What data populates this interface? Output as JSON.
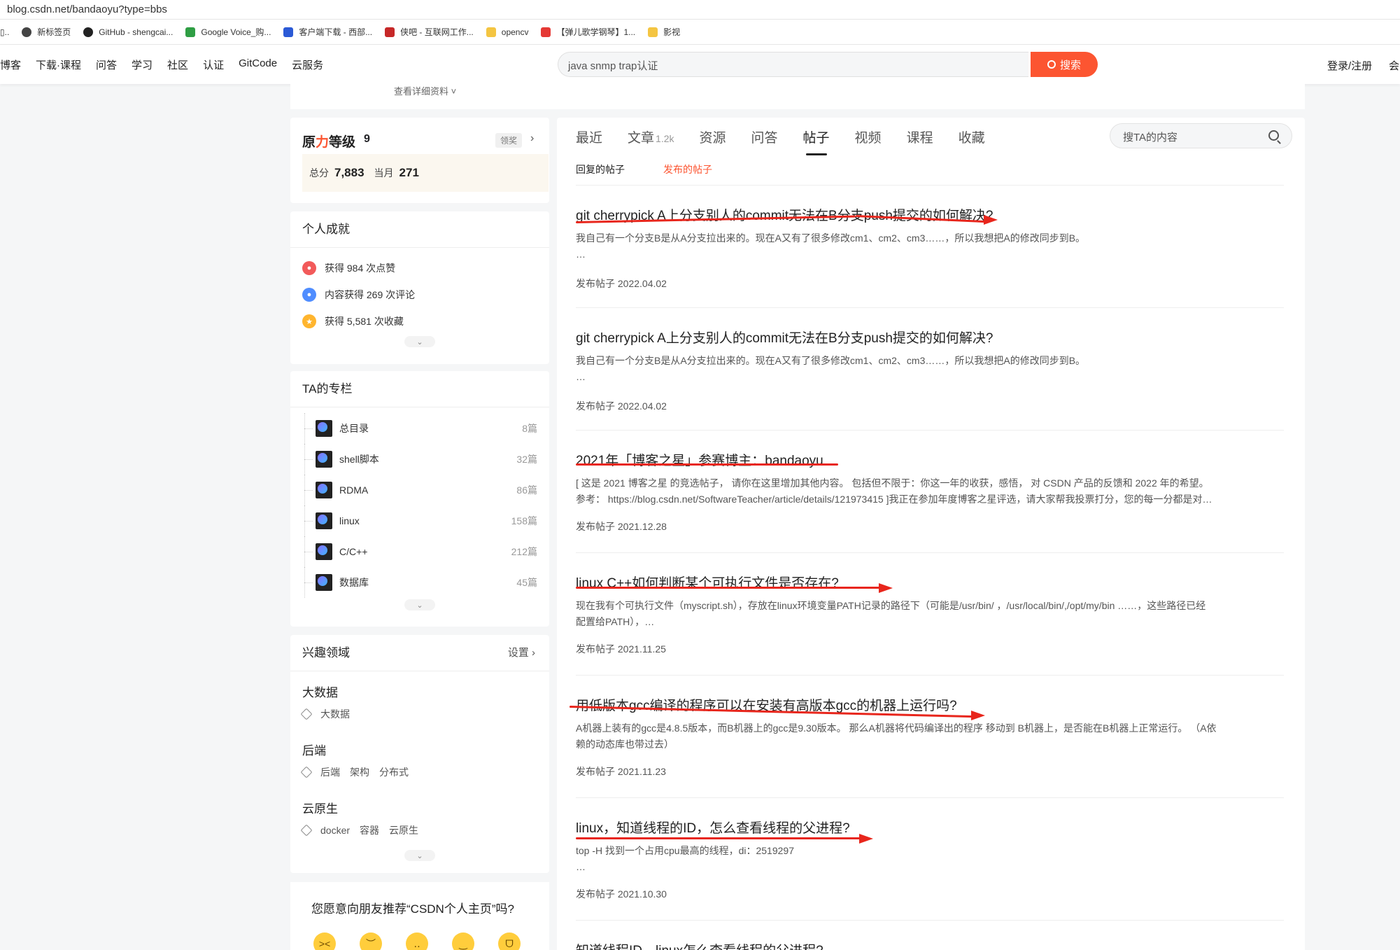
{
  "browser": {
    "url": "blog.csdn.net/bandaoyu?type=bbs",
    "bookmarks": [
      "新标签页",
      "GitHub - shengcai...",
      "Google Voice_购...",
      "客户端下载 - 西部...",
      "侠吧 - 互联网工作...",
      "opencv",
      "【弹儿歌学钢琴】1...",
      "影视"
    ],
    "bookmark_colors": [
      "#444444",
      "#222222",
      "#2f9e44",
      "#2b5ad6",
      "#c62828",
      "#f4c542",
      "#e53935",
      "#f4c542"
    ]
  },
  "topnav": {
    "links": [
      "博客",
      "下载·课程",
      "问答",
      "学习",
      "社区",
      "认证",
      "GitCode",
      "云服务"
    ],
    "search_value": "java snmp trap认证",
    "search_button": "搜索",
    "login": "登录/注册",
    "extra": "会"
  },
  "profile_strip": {
    "text": "查看详细资料 ˅"
  },
  "level": {
    "title_prefix": "原",
    "title_red": "力",
    "title_suffix": "等级",
    "value": "9",
    "award": "领奖",
    "total_label": "总分",
    "total": "7,883",
    "month_label": "当月",
    "month": "271"
  },
  "achievements": {
    "title": "个人成就",
    "items": [
      {
        "text": "获得 984 次点赞",
        "color": "#f25a5a"
      },
      {
        "text": "内容获得 269 次评论",
        "color": "#4f8dff"
      },
      {
        "text": "获得 5,581 次收藏",
        "color": "#ffb52e"
      }
    ]
  },
  "columns": {
    "title": "TA的专栏",
    "items": [
      {
        "name": "总目录",
        "count": "8篇"
      },
      {
        "name": "shell脚本",
        "count": "32篇"
      },
      {
        "name": "RDMA",
        "count": "86篇"
      },
      {
        "name": "linux",
        "count": "158篇"
      },
      {
        "name": "C/C++",
        "count": "212篇"
      },
      {
        "name": "数据库",
        "count": "45篇"
      }
    ]
  },
  "interests": {
    "title": "兴趣领域",
    "settings": "设置",
    "groups": [
      {
        "head": "大数据",
        "tags": [
          "大数据"
        ]
      },
      {
        "head": "后端",
        "tags": [
          "后端",
          "架构",
          "分布式"
        ]
      },
      {
        "head": "云原生",
        "tags": [
          "docker",
          "容器",
          "云原生"
        ]
      }
    ]
  },
  "recommend": {
    "text": "您愿意向朋友推荐“CSDN个人主页”吗?"
  },
  "tabs": {
    "items": [
      "最近",
      "文章",
      "资源",
      "问答",
      "帖子",
      "视频",
      "课程",
      "收藏"
    ],
    "article_count": "1.2k",
    "active": "帖子",
    "search_placeholder": "搜TA的内容",
    "sub": [
      "回复的帖子",
      "发布的帖子"
    ]
  },
  "posts": [
    {
      "title": "git cherrypick A上分支别人的commit无法在B分支push提交的如何解决?",
      "desc": "我自己有一个分支B是从A分支拉出来的。现在A又有了很多修改cm1、cm2、cm3……，所以我想把A的修改同步到B。",
      "desc2": "…",
      "date": "发布帖子 2022.04.02"
    },
    {
      "title": "git cherrypick A上分支别人的commit无法在B分支push提交的如何解决?",
      "desc": "我自己有一个分支B是从A分支拉出来的。现在A又有了很多修改cm1、cm2、cm3……，所以我想把A的修改同步到B。",
      "desc2": "…",
      "date": "发布帖子 2022.04.02"
    },
    {
      "title": "2021年「博客之星」参赛博主：bandaoyu",
      "desc": "[ 这是 2021 博客之星 的竞选帖子， 请你在这里增加其他内容。 包括但不限于：你这一年的收获，感悟， 对 CSDN 产品的反馈和 2022 年的希望。",
      "desc2": "参考： https://blog.csdn.net/SoftwareTeacher/article/details/121973415 ]我正在参加年度博客之星评选，请大家帮我投票打分，您的每一分都是对…",
      "date": "发布帖子 2021.12.28"
    },
    {
      "title": "linux C++如何判断某个可执行文件是否存在?",
      "desc": "现在我有个可执行文件（myscript.sh），存放在linux环境变量PATH记录的路径下（可能是/usr/bin/ ，/usr/local/bin/,/opt/my/bin ……，这些路径已经",
      "desc2": "配置给PATH），…",
      "date": "发布帖子 2021.11.25"
    },
    {
      "title": "用低版本gcc编译的程序可以在安装有高版本gcc的机器上运行吗?",
      "desc": "A机器上装有的gcc是4.8.5版本，而B机器上的gcc是9.30版本。 那么A机器将代码编译出的程序 移动到 B机器上，是否能在B机器上正常运行。 （A依",
      "desc2": "赖的动态库也带过去）",
      "date": "发布帖子 2021.11.23"
    },
    {
      "title": "linux，知道线程的ID，怎么查看线程的父进程?",
      "desc": "top -H 找到一个占用cpu最高的线程，di：2519297",
      "desc2": "…",
      "date": "发布帖子 2021.10.30"
    },
    {
      "title": "知道线程ID，linux怎么查看线程的父进程?",
      "desc": "",
      "desc2": "",
      "date": ""
    }
  ]
}
